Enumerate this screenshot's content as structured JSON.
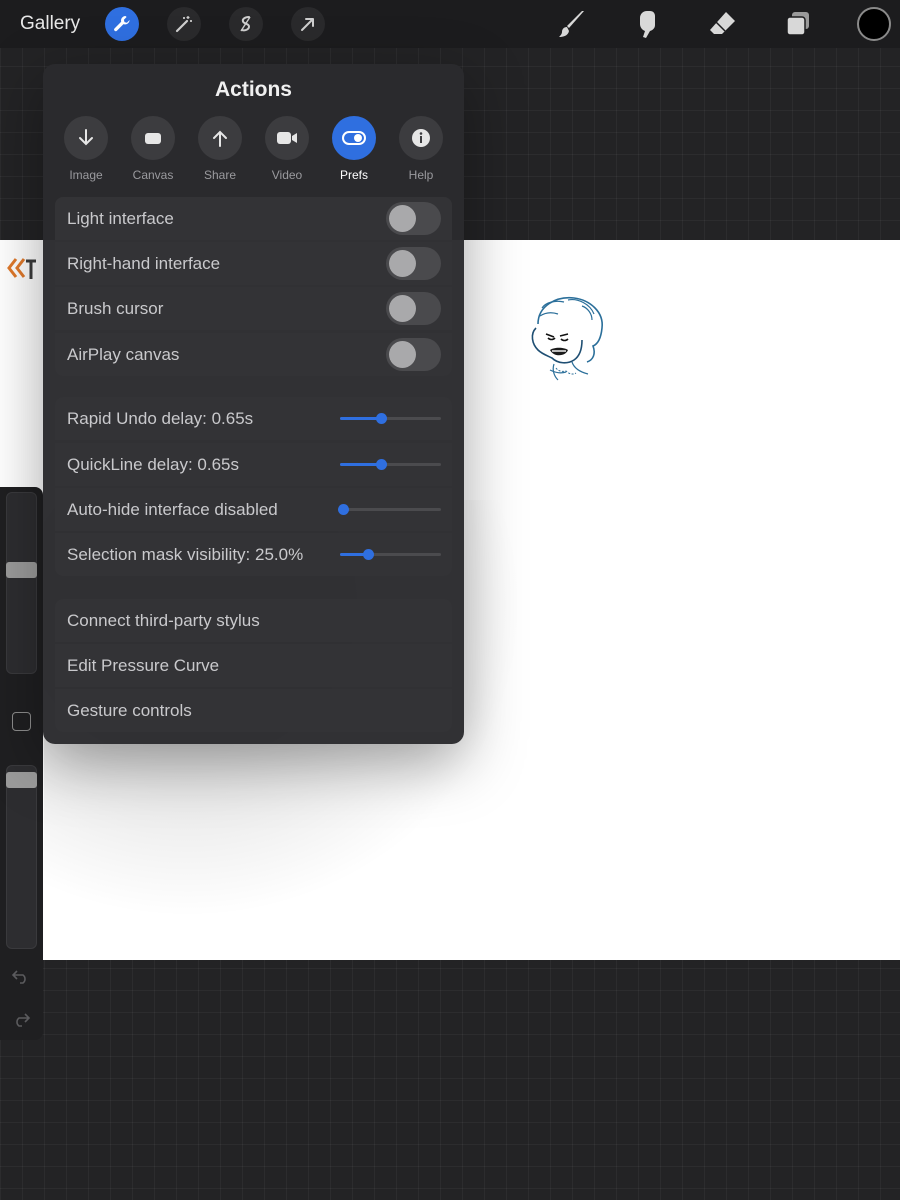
{
  "topbar": {
    "gallery_label": "Gallery",
    "left_tools": [
      {
        "icon": "wrench-icon",
        "active": true
      },
      {
        "icon": "magic-wand-icon",
        "active": false
      },
      {
        "icon": "selection-icon",
        "active": false
      },
      {
        "icon": "transform-arrow-icon",
        "active": false
      }
    ],
    "right_tools": [
      "brush-icon",
      "smudge-icon",
      "eraser-icon",
      "layers-icon"
    ],
    "current_color": "#000000"
  },
  "actions_panel": {
    "title": "Actions",
    "tabs": [
      {
        "label": "Image",
        "icon": "download-arrow-icon",
        "active": false
      },
      {
        "label": "Canvas",
        "icon": "canvas-icon",
        "active": false
      },
      {
        "label": "Share",
        "icon": "share-arrow-icon",
        "active": false
      },
      {
        "label": "Video",
        "icon": "video-camera-icon",
        "active": false
      },
      {
        "label": "Prefs",
        "icon": "toggle-icon",
        "active": true
      },
      {
        "label": "Help",
        "icon": "info-icon",
        "active": false
      }
    ],
    "toggles": [
      {
        "label": "Light interface",
        "on": false
      },
      {
        "label": "Right-hand interface",
        "on": false
      },
      {
        "label": "Brush cursor",
        "on": false
      },
      {
        "label": "AirPlay canvas",
        "on": false
      }
    ],
    "sliders": [
      {
        "label": "Rapid Undo delay: 0.65s",
        "level": 0.38
      },
      {
        "label": "QuickLine delay: 0.65s",
        "level": 0.38
      },
      {
        "label": "Auto-hide interface disabled",
        "level": 0.0
      },
      {
        "label": "Selection mask visibility: 25.0%",
        "level": 0.25
      }
    ],
    "links": [
      {
        "label": "Connect third-party stylus"
      },
      {
        "label": "Edit Pressure Curve"
      },
      {
        "label": "Gesture controls"
      }
    ]
  },
  "sidebar": {
    "brush_size_level": 0.58,
    "opacity_level": 0.98
  },
  "colors": {
    "accent": "#2f6fe0",
    "panel": "#2a2a2d",
    "row": "#333336"
  }
}
